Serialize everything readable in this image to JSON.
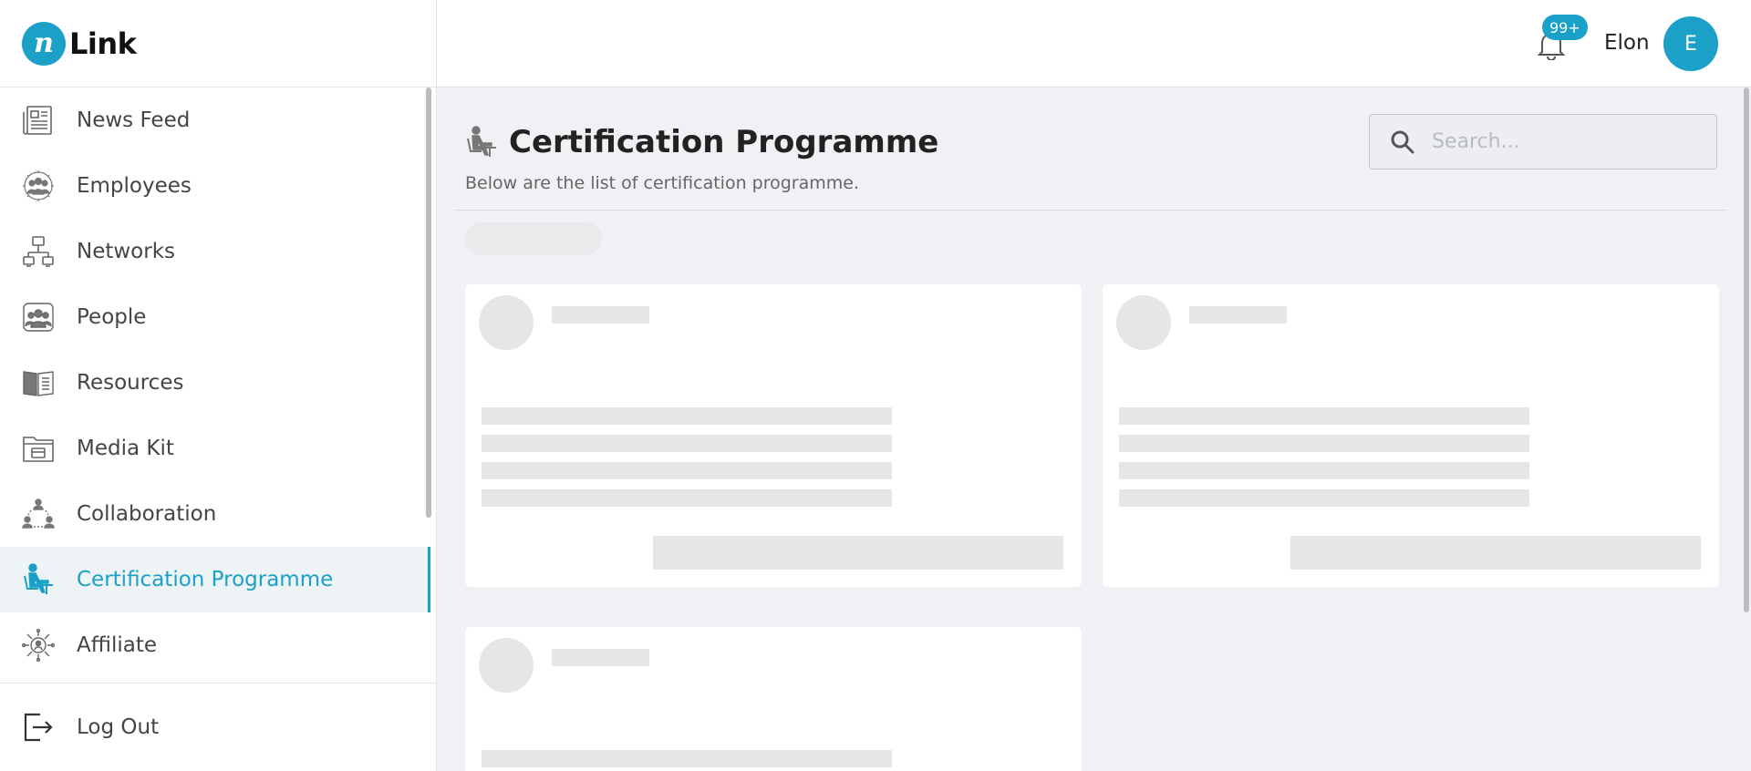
{
  "brand": {
    "logo_mark": "n",
    "name": "Link",
    "accent_color": "#1ba1c7"
  },
  "header": {
    "notification_icon": "bell-icon",
    "notification_badge": "99+",
    "user_name": "Elon",
    "avatar_initial": "E"
  },
  "sidebar": {
    "items": [
      {
        "label": "News Feed",
        "icon": "newspaper-icon",
        "active": false
      },
      {
        "label": "Employees",
        "icon": "employees-icon",
        "active": false
      },
      {
        "label": "Networks",
        "icon": "network-icon",
        "active": false
      },
      {
        "label": "People",
        "icon": "people-icon",
        "active": false
      },
      {
        "label": "Resources",
        "icon": "book-icon",
        "active": false
      },
      {
        "label": "Media Kit",
        "icon": "folder-icon",
        "active": false
      },
      {
        "label": "Collaboration",
        "icon": "collaboration-icon",
        "active": false
      },
      {
        "label": "Certification Programme",
        "icon": "certification-icon",
        "active": true
      },
      {
        "label": "Affiliate",
        "icon": "affiliate-icon",
        "active": false
      }
    ],
    "logout_label": "Log Out"
  },
  "main": {
    "title": "Certification Programme",
    "subtitle": "Below are the list of certification programme.",
    "search": {
      "placeholder": "Search...",
      "value": ""
    },
    "loading": true
  }
}
